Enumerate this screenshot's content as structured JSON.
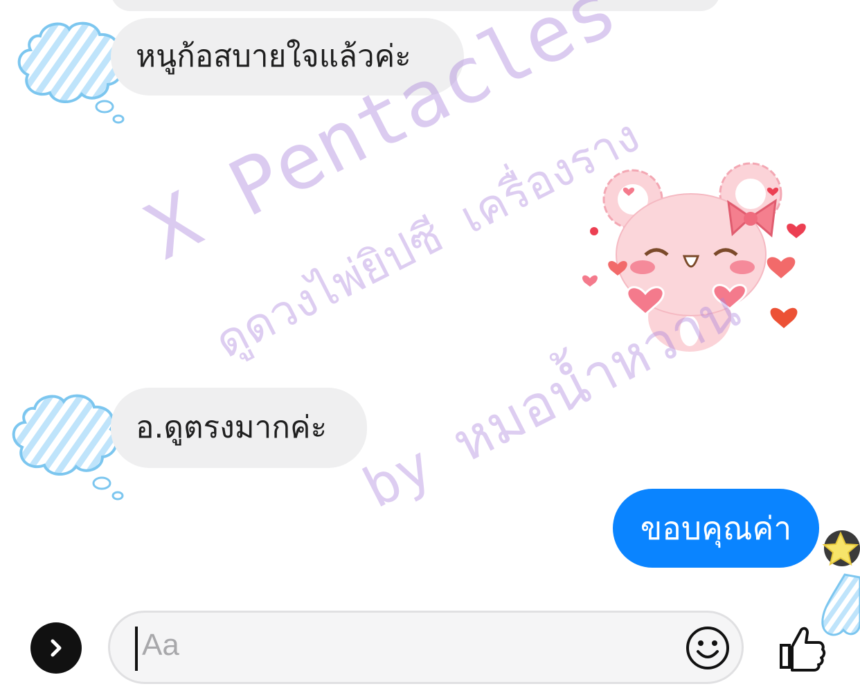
{
  "conversation": {
    "messages": [
      {
        "sender": "them",
        "text": "หนูก้อสบายใจแล้วค่ะ"
      },
      {
        "sender": "them",
        "type": "sticker",
        "sticker": "pink-bear-hearts"
      },
      {
        "sender": "them",
        "text": "อ.ดูตรงมากค่ะ"
      },
      {
        "sender": "me",
        "text": "ขอบคุณค่า"
      }
    ]
  },
  "watermark": {
    "line1": "X Pentacles",
    "line2": "ดูดวงไพ่ยิปซี เครื่องราง",
    "line3": "by หมอน้ำหวาน"
  },
  "composer": {
    "placeholder": "Aa"
  },
  "colors": {
    "outgoing_bubble": "#0a84ff",
    "incoming_bubble": "#efeff0",
    "watermark": "#aa82dc"
  },
  "icons": [
    "chevron-right-icon",
    "smiley-icon",
    "thumbs-up-icon"
  ]
}
